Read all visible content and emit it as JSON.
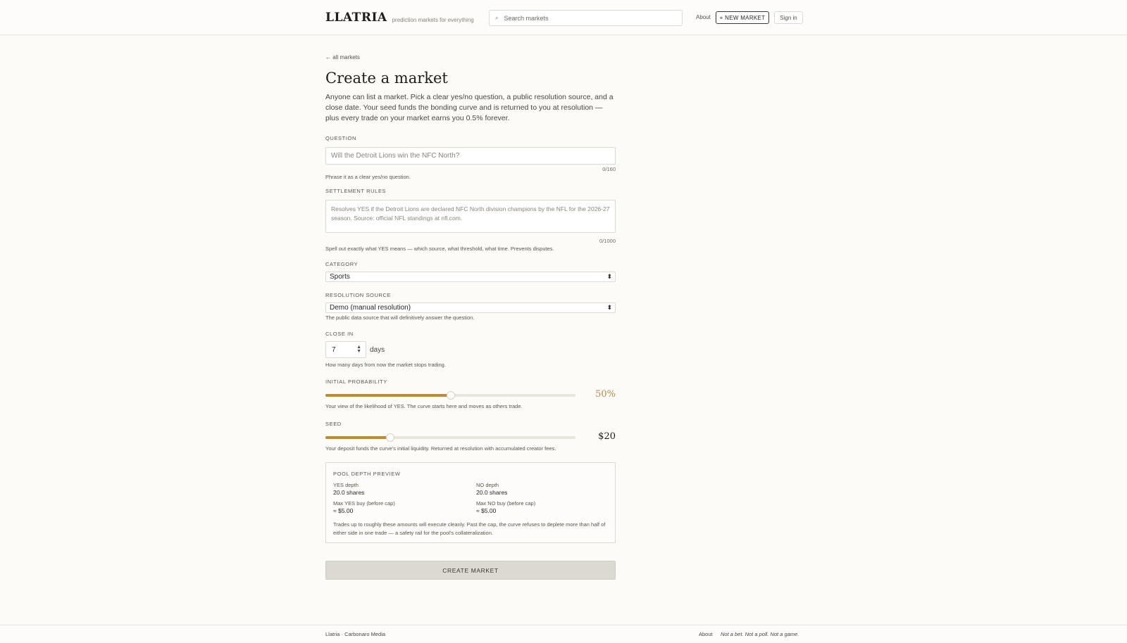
{
  "header": {
    "logo": "LLATRIA",
    "tagline": "prediction markets for everything",
    "search_placeholder": "Search markets",
    "search_icon": "search-icon",
    "about": "About",
    "new_market": "+ NEW MARKET",
    "sign_in": "Sign in"
  },
  "page": {
    "back_link": "← all markets",
    "title": "Create a market",
    "intro": "Anyone can list a market. Pick a clear yes/no question, a public resolution source, and a close date. Your seed funds the bonding curve and is returned to you at resolution — plus every trade on your market earns you 0.5% forever."
  },
  "form": {
    "question": {
      "label": "QUESTION",
      "placeholder": "Will the Detroit Lions win the NFC North?",
      "counter": "0/160",
      "hint": "Phrase it as a clear yes/no question."
    },
    "rules": {
      "label": "SETTLEMENT RULES",
      "placeholder": "Resolves YES if the Detroit Lions are declared NFC North division champions by the NFL for the 2026-27 season. Source: official NFL standings at nfl.com.",
      "counter": "0/1000",
      "hint": "Spell out exactly what YES means — which source, what threshold, what time. Prevents disputes."
    },
    "category": {
      "label": "CATEGORY",
      "value": "Sports"
    },
    "source": {
      "label": "RESOLUTION SOURCE",
      "value": "Demo (manual resolution)",
      "hint": "The public data source that will definitively answer the question."
    },
    "close": {
      "label": "CLOSE IN",
      "value": "7",
      "unit": "days",
      "hint": "How many days from now the market stops trading."
    },
    "probability": {
      "label": "INITIAL PROBABILITY",
      "value_text": "50%",
      "fraction": 0.5,
      "color": "#b88a45",
      "hint": "Your view of the likelihood of YES. The curve starts here and moves as others trade."
    },
    "seed": {
      "label": "SEED",
      "value_text": "$20",
      "fraction": 0.26,
      "hint": "Your deposit funds the curve's initial liquidity. Returned at resolution with accumulated creator fees."
    },
    "pool": {
      "title": "POOL DEPTH PREVIEW",
      "yes_depth_label": "YES depth",
      "yes_depth": "20.0 shares",
      "no_depth_label": "NO depth",
      "no_depth": "20.0 shares",
      "max_yes_label": "Max YES buy (before cap)",
      "max_yes": "≈ $5.00",
      "max_no_label": "Max NO buy (before cap)",
      "max_no": "≈ $5.00",
      "note": "Trades up to roughly these amounts will execute cleanly. Past the cap, the curve refuses to deplete more than half of either side in one trade — a safety rail for the pool's collateralization."
    },
    "submit": "CREATE MARKET"
  },
  "footer": {
    "left": "Llatria · Carbonaro Media",
    "about": "About",
    "tagline": "Not a bet. Not a poll. Not a game."
  }
}
